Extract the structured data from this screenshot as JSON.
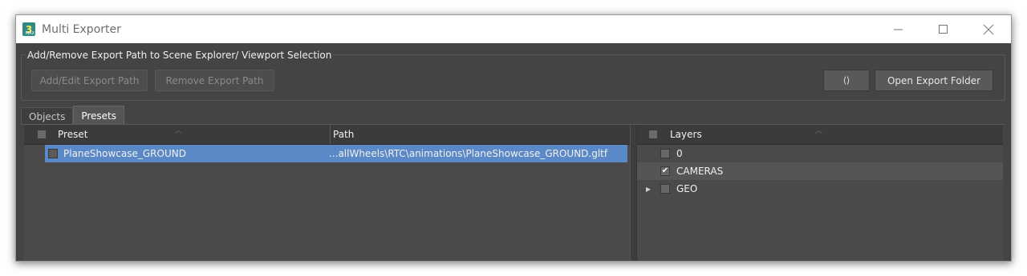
{
  "window": {
    "title": "Multi Exporter",
    "icon_label": "3",
    "controls": {
      "minimize": "─",
      "maximize": "☐",
      "close": "✕"
    }
  },
  "export_group": {
    "label": "Add/Remove Export Path to Scene Explorer/ Viewport Selection",
    "add_edit_button": "Add/Edit Export Path",
    "remove_button": "Remove Export Path",
    "refresh_button": "⟳",
    "open_folder_button": "Open Export Folder"
  },
  "tabs": [
    {
      "label": "Objects"
    },
    {
      "label": "Presets"
    }
  ],
  "presets_table": {
    "columns": {
      "preset": "Preset",
      "path": "Path"
    },
    "rows": [
      {
        "preset": "PlaneShowcase_GROUND",
        "path": "...allWheels\\RTC\\animations\\PlaneShowcase_GROUND.gltf"
      }
    ]
  },
  "layers_table": {
    "column": "Layers",
    "rows": [
      {
        "name": "0",
        "checked": ""
      },
      {
        "name": "CAMERAS",
        "checked": "✔"
      },
      {
        "name": "GEO",
        "checked": "",
        "expander": "▶"
      }
    ]
  }
}
